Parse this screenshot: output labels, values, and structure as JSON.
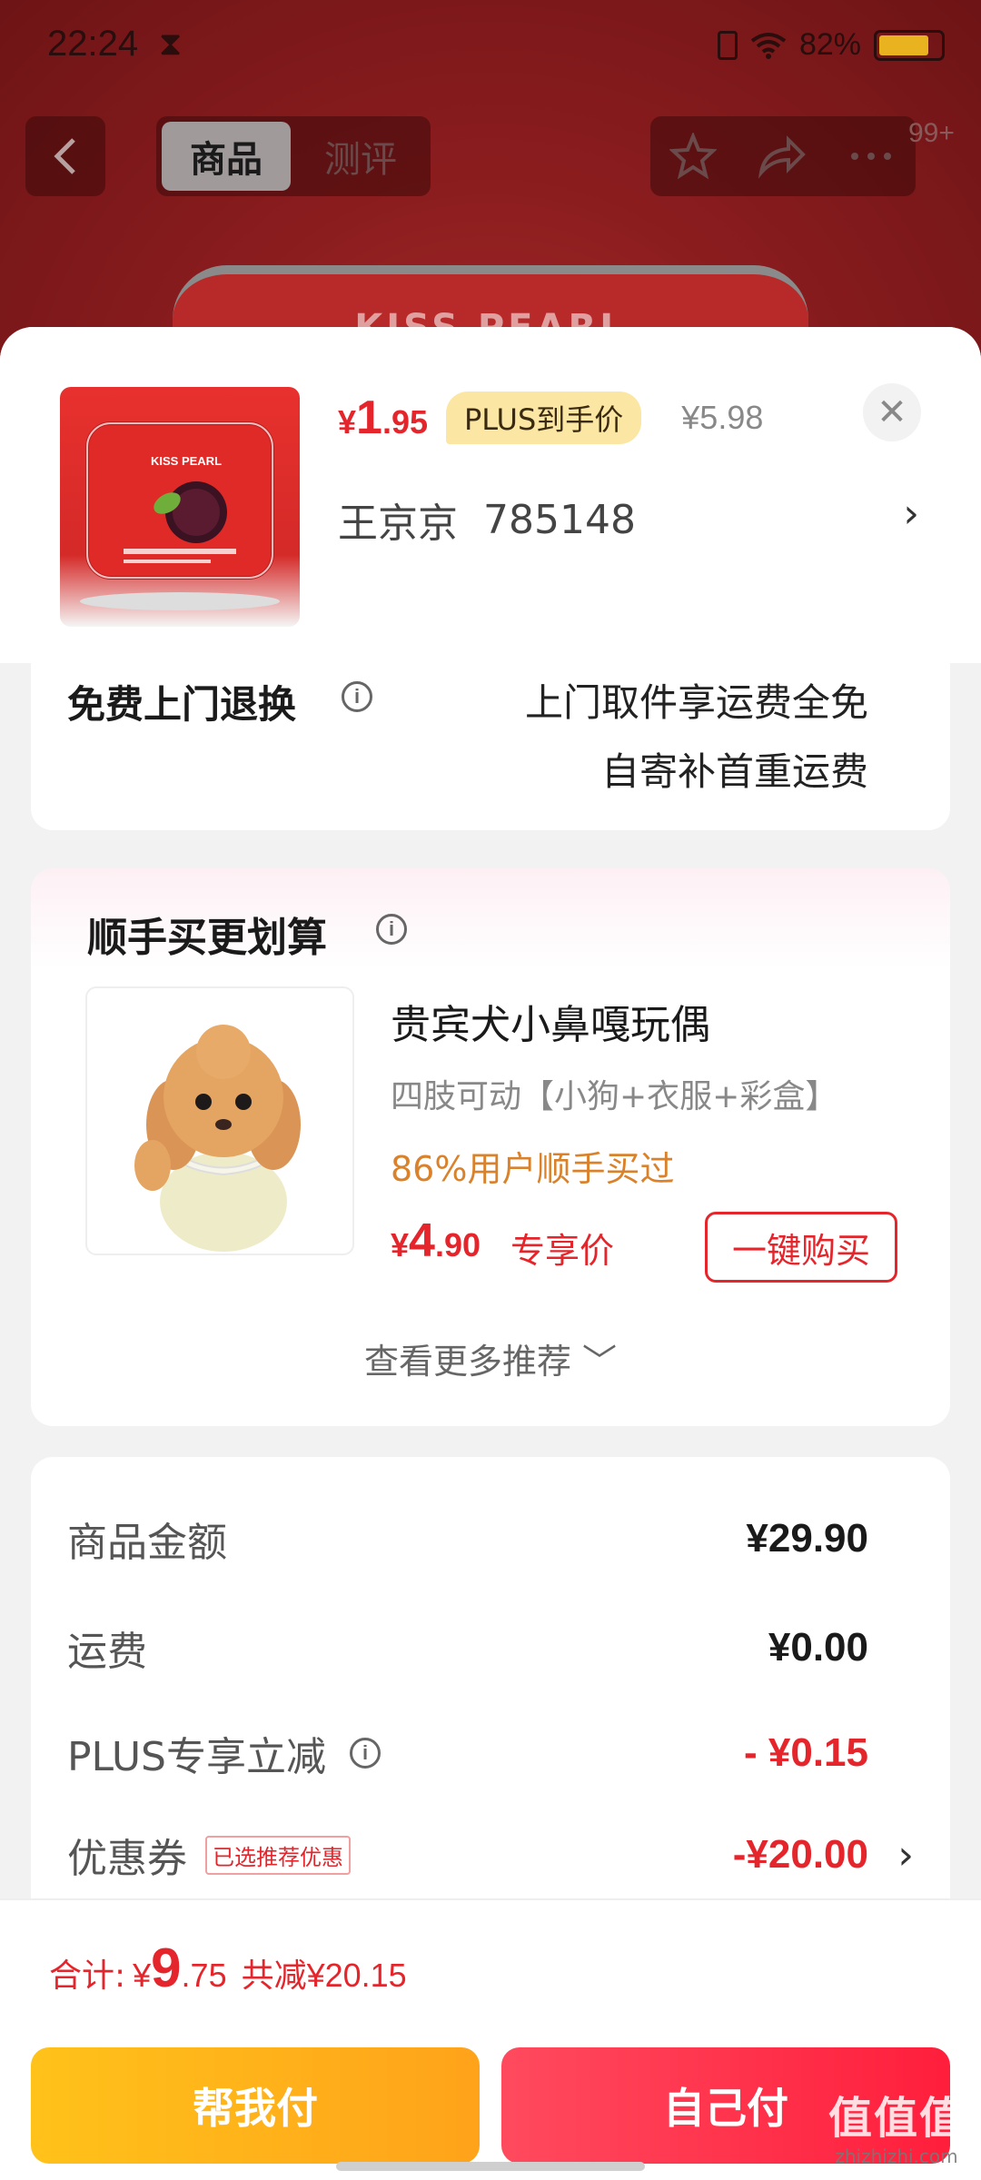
{
  "status_bar": {
    "time": "22:24",
    "battery": "82%"
  },
  "nav": {
    "tabs": [
      {
        "label": "商品",
        "active": true
      },
      {
        "label": "测评",
        "active": false
      }
    ],
    "badge": "99+"
  },
  "background": {
    "brand_text": "KISS PEARL"
  },
  "sheet": {
    "product": {
      "price_currency": "¥",
      "price_int": "1",
      "price_dec": ".95",
      "plus_tag": "PLUS到手价",
      "original_price": "¥5.98",
      "thumbnail_brand": "KISS PEARL"
    },
    "address": {
      "name": "王京京",
      "phone": "785148"
    },
    "return_service": {
      "title": "免费上门退换",
      "line1": "上门取件享运费全免",
      "line2": "自寄补首重运费"
    },
    "bundle": {
      "title": "顺手买更划算",
      "item_name": "贵宾犬小鼻嘎玩偶",
      "item_spec": "四肢可动【小狗+衣服+彩盒】",
      "item_stat": "86%用户顺手买过",
      "price_currency": "¥",
      "price_int": "4",
      "price_dec": ".90",
      "price_label": "专享价",
      "buy_label": "一键购买",
      "more_label": "查看更多推荐"
    },
    "fees": [
      {
        "label": "商品金额",
        "value": "¥29.90"
      },
      {
        "label": "运费",
        "value": "¥0.00"
      },
      {
        "label": "PLUS专享立减",
        "value": "- ¥0.15"
      },
      {
        "label": "优惠券",
        "tag": "已选推荐优惠",
        "value": "-¥20.00"
      }
    ]
  },
  "footer": {
    "total_label": "合计:",
    "total_currency": "¥",
    "total_int": "9",
    "total_dec": ".75",
    "saved": "共减¥20.15",
    "help_pay": "帮我付",
    "self_pay": "自己付"
  },
  "watermark": {
    "logo": "值值值",
    "url": "zhizhizhi.com"
  },
  "colors": {
    "accent_red": "#e4252b",
    "plus_gold": "#fbe7a3",
    "help_yellow": "#ffb41a",
    "self_red": "#ff2e48"
  }
}
